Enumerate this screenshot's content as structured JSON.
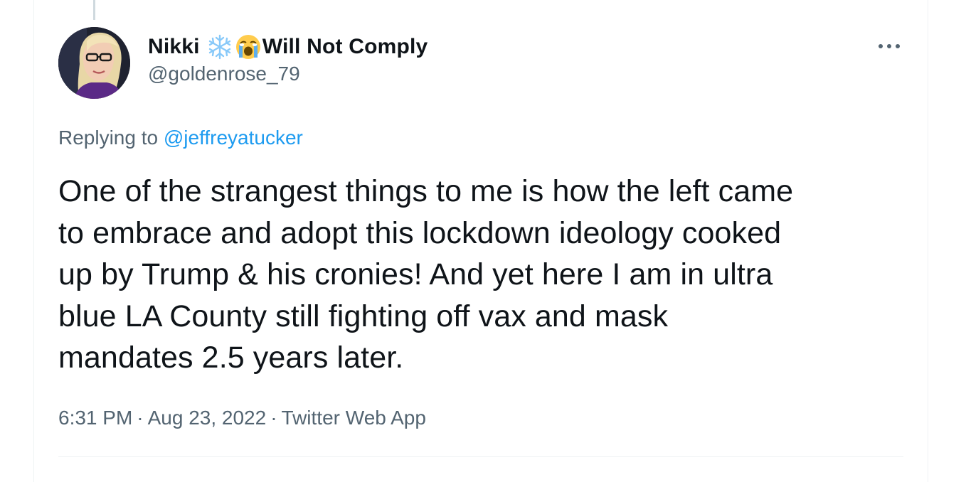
{
  "tweet": {
    "display_name_first": "Nikki",
    "display_name_emojis": [
      "snowflake-emoji",
      "crying-face-emoji"
    ],
    "display_name_rest": "Will Not Comply",
    "handle": "@goldenrose_79",
    "replying_prefix": "Replying to",
    "replying_to": "@jeffreyatucker",
    "text": "One of the strangest things to me is how the left came\nto embrace and adopt this lockdown ideology cooked\nup by Trump & his cronies! And yet here I am in ultra\nblue LA County still fighting off vax and mask\nmandates 2.5 years later.",
    "time": "6:31 PM",
    "date": "Aug 23, 2022",
    "separator": "·",
    "source": "Twitter Web App"
  },
  "icons": {
    "more": "more-horizontal-icon",
    "avatar": "avatar"
  },
  "colors": {
    "text_primary": "#0f1419",
    "text_secondary": "#536471",
    "accent": "#1d9bf0",
    "border": "#eff3f4",
    "thread_line": "#cfd9de"
  }
}
